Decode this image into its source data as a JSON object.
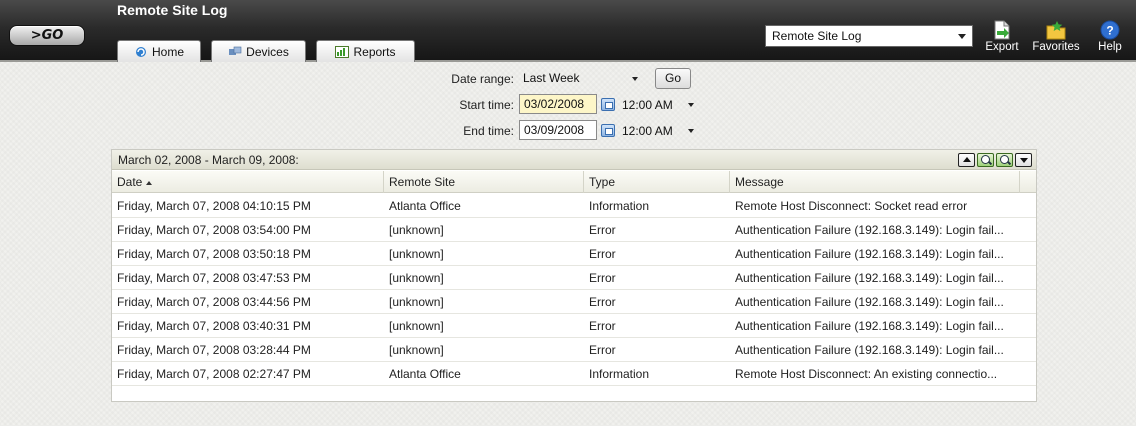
{
  "header": {
    "go_label": ">GO",
    "title": "Remote Site Log",
    "tabs": [
      {
        "label": "Home",
        "icon": "home-icon"
      },
      {
        "label": "Devices",
        "icon": "devices-icon"
      },
      {
        "label": "Reports",
        "icon": "reports-icon"
      }
    ],
    "site_select": "Remote Site Log",
    "tools": [
      {
        "label": "Export",
        "icon": "export-icon"
      },
      {
        "label": "Favorites",
        "icon": "favorites-icon"
      },
      {
        "label": "Help",
        "icon": "help-icon"
      }
    ]
  },
  "filters": {
    "date_range_label": "Date range:",
    "date_range_value": "Last Week",
    "go_label": "Go",
    "start_label": "Start time:",
    "start_date": "03/02/2008",
    "start_time": "12:00 AM",
    "end_label": "End time:",
    "end_date": "03/09/2008",
    "end_time": "12:00 AM"
  },
  "grid": {
    "caption": "March 02, 2008 - March 09, 2008:",
    "columns": [
      "Date",
      "Remote Site",
      "Type",
      "Message"
    ],
    "rows": [
      [
        "Friday, March 07, 2008 04:10:15 PM",
        "Atlanta Office",
        "Information",
        "Remote Host Disconnect: Socket read error"
      ],
      [
        "Friday, March 07, 2008 03:54:00 PM",
        "[unknown]",
        "Error",
        "Authentication Failure (192.168.3.149): Login fail..."
      ],
      [
        "Friday, March 07, 2008 03:50:18 PM",
        "[unknown]",
        "Error",
        "Authentication Failure (192.168.3.149): Login fail..."
      ],
      [
        "Friday, March 07, 2008 03:47:53 PM",
        "[unknown]",
        "Error",
        "Authentication Failure (192.168.3.149): Login fail..."
      ],
      [
        "Friday, March 07, 2008 03:44:56 PM",
        "[unknown]",
        "Error",
        "Authentication Failure (192.168.3.149): Login fail..."
      ],
      [
        "Friday, March 07, 2008 03:40:31 PM",
        "[unknown]",
        "Error",
        "Authentication Failure (192.168.3.149): Login fail..."
      ],
      [
        "Friday, March 07, 2008 03:28:44 PM",
        "[unknown]",
        "Error",
        "Authentication Failure (192.168.3.149): Login fail..."
      ],
      [
        "Friday, March 07, 2008 02:27:47 PM",
        "Atlanta Office",
        "Information",
        "Remote Host Disconnect: An existing connectio..."
      ]
    ]
  }
}
